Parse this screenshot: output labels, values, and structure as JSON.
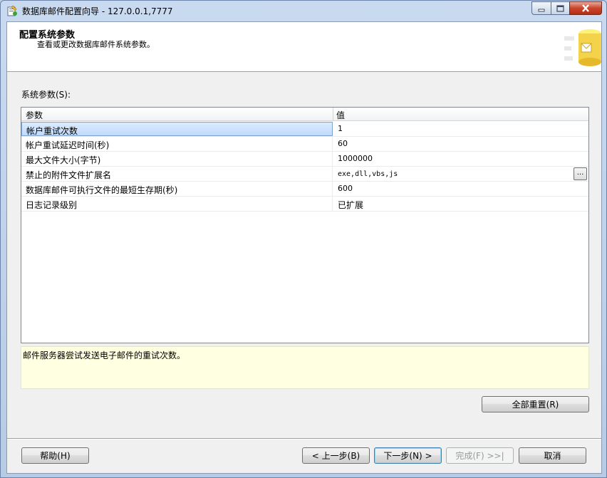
{
  "window": {
    "title": "数据库邮件配置向导 - 127.0.0.1,7777"
  },
  "header": {
    "title": "配置系统参数",
    "subtitle": "查看或更改数据库邮件系统参数。"
  },
  "section": {
    "label": "系统参数(S):"
  },
  "grid": {
    "columns": [
      "参数",
      "值"
    ],
    "rows": [
      {
        "param": "帐户重试次数",
        "value": "1"
      },
      {
        "param": "帐户重试延迟时间(秒)",
        "value": "60"
      },
      {
        "param": "最大文件大小(字节)",
        "value": "1000000"
      },
      {
        "param": "禁止的附件文件扩展名",
        "value": "exe,dll,vbs,js",
        "button": "..."
      },
      {
        "param": "数据库邮件可执行文件的最短生存期(秒)",
        "value": "600"
      },
      {
        "param": "日志记录级别",
        "value": "已扩展"
      }
    ],
    "selected_row": 0
  },
  "description": {
    "text": "邮件服务器尝试发送电子邮件的重试次数。"
  },
  "buttons": {
    "reset_all": "全部重置(R)",
    "help": "帮助(H)",
    "prev": "< 上一步(B)",
    "next": "下一步(N) >",
    "finish": "完成(F) >>|",
    "cancel": "取消"
  },
  "colors": {
    "selection": "#c1dbfc",
    "description_bg": "#ffffe1",
    "close_button": "#c9452b"
  }
}
